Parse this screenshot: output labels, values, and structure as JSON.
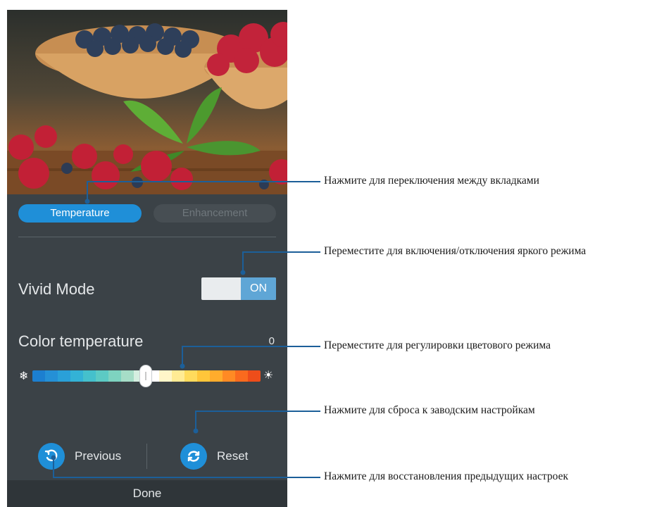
{
  "tabs": {
    "temperature": "Temperature",
    "enhancement": "Enhancement"
  },
  "vivid_mode": {
    "label": "Vivid Mode",
    "state": "ON"
  },
  "color_temperature": {
    "label": "Color temperature",
    "value": "0",
    "cold_icon": "snowflake-icon",
    "warm_icon": "sun-icon",
    "gradient_colors": [
      "#1c7fd0",
      "#2590d6",
      "#2aa0d8",
      "#33b2d6",
      "#45c0cc",
      "#5ccac4",
      "#7ed3c0",
      "#a6ddc7",
      "#d5eee0",
      "#ffffff",
      "#fff6c9",
      "#ffeb94",
      "#ffdb5c",
      "#ffc63a",
      "#ffac2c",
      "#ff8a24",
      "#fa6a1e",
      "#ee4d1a"
    ]
  },
  "actions": {
    "previous": "Previous",
    "reset": "Reset",
    "done": "Done"
  },
  "annotations": [
    "Нажмите для переключения между вкладками",
    "Переместите для включения/отключения яркого режима",
    "Переместите для регулировки цветового режима",
    "Нажмите для сброса к заводским настройкам",
    "Нажмите для восстановления предыдущих настроек"
  ],
  "colors": {
    "accent": "#1f8fd8",
    "callout_line": "#1c5f99",
    "panel": "#3b4247"
  }
}
